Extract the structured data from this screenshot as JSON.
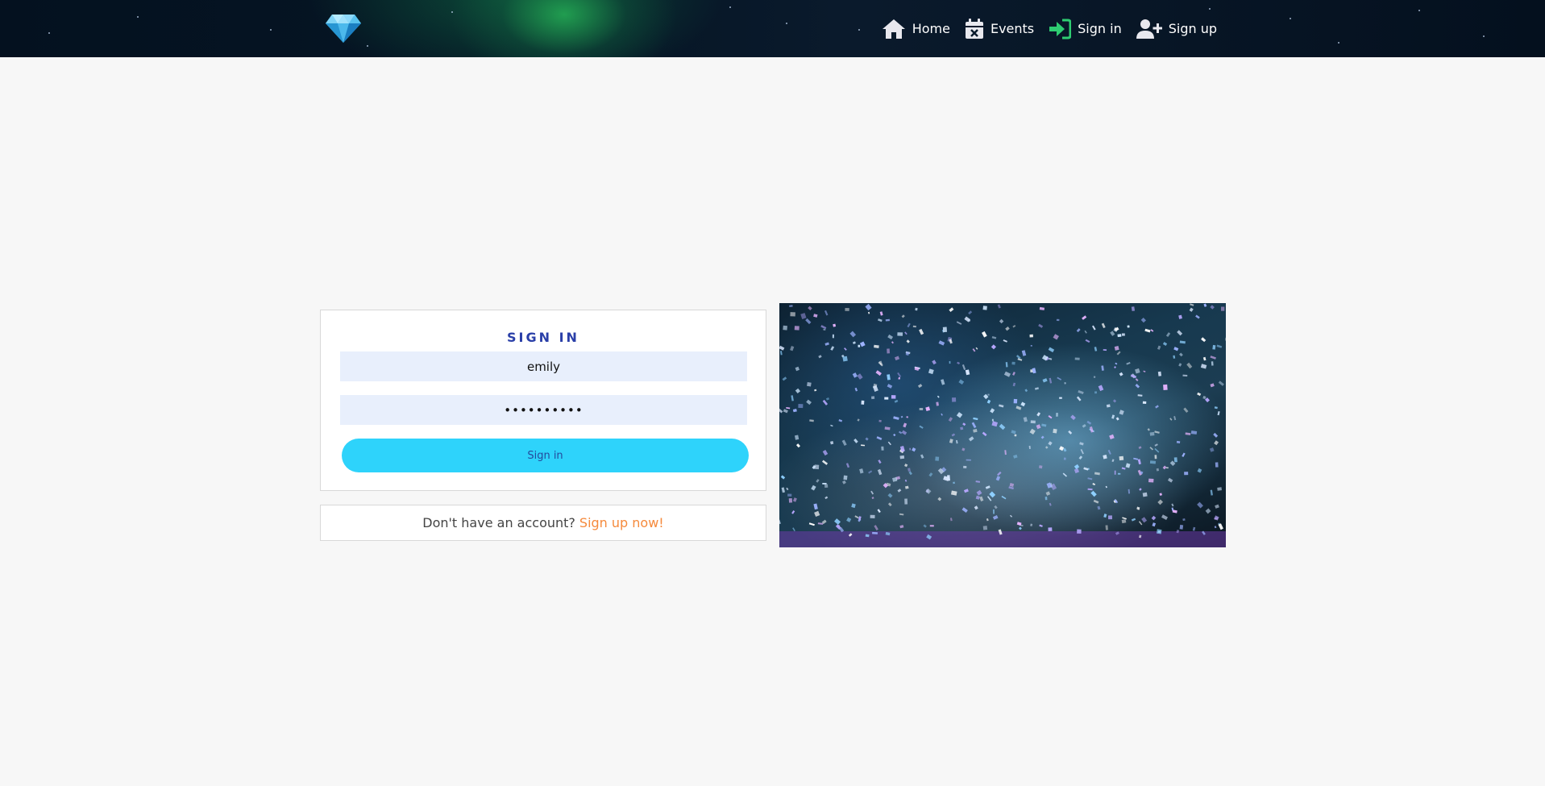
{
  "nav": {
    "logo_icon": "diamond-icon",
    "items": [
      {
        "label": "Home",
        "icon": "home-icon"
      },
      {
        "label": "Events",
        "icon": "calendar-x-icon"
      },
      {
        "label": "Sign in",
        "icon": "sign-in-icon"
      },
      {
        "label": "Sign up",
        "icon": "user-plus-icon"
      }
    ]
  },
  "signin": {
    "title": "SIGN IN",
    "username_value": "emily",
    "password_value": "••••••••••",
    "button_label": "Sign in"
  },
  "signup_prompt": {
    "text": "Don't have an account?",
    "link": "Sign up now!"
  },
  "colors": {
    "accent_button": "#2ed3fb",
    "title": "#2a3fa8",
    "link": "#f58a3c",
    "field_bg": "#e8effc",
    "signin_icon": "#2ecc71"
  }
}
